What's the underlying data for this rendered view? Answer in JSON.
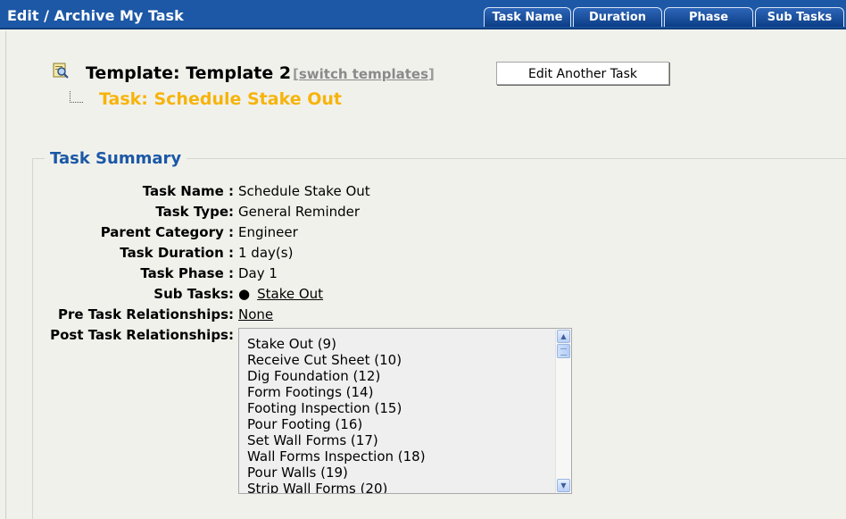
{
  "header": {
    "title": "Edit / Archive My Task",
    "tabs": [
      {
        "label": "Task Name"
      },
      {
        "label": "Duration"
      },
      {
        "label": "Phase"
      },
      {
        "label": "Sub Tasks"
      }
    ]
  },
  "template": {
    "label": "Template: Template 2",
    "switch_link": "switch templates",
    "edit_button": "Edit Another Task"
  },
  "task": {
    "label": "Task: Schedule Stake Out"
  },
  "summary": {
    "legend": "Task Summary",
    "fields": [
      {
        "label": "Task Name :",
        "value": "Schedule Stake Out"
      },
      {
        "label": "Task Type:",
        "value": "General Reminder"
      },
      {
        "label": "Parent Category :",
        "value": "Engineer"
      },
      {
        "label": "Task Duration :",
        "value": "1 day(s)"
      },
      {
        "label": "Task Phase :",
        "value": "Day 1"
      },
      {
        "label": "Sub Tasks:",
        "value": "Stake Out"
      },
      {
        "label": "Pre Task Relationships:",
        "value": "None"
      },
      {
        "label": "Post Task Relationships:"
      }
    ],
    "post_relationships": [
      "Stake Out (9)",
      "Receive Cut Sheet (10)",
      "Dig Foundation (12)",
      "Form Footings (14)",
      "Footing Inspection (15)",
      "Pour Footing (16)",
      "Set Wall Forms (17)",
      "Wall Forms Inspection (18)",
      "Pour Walls (19)",
      "Strip Wall Forms (20)"
    ]
  },
  "icons": {
    "template": "magnifier-document-icon",
    "scroll_up": "scroll-up-arrow-icon",
    "scroll_down": "scroll-down-arrow-icon",
    "bullet": "bullet-icon"
  },
  "colors": {
    "header_bg": "#1c58a6",
    "task_label": "#f6b40b",
    "legend": "#1b58a6"
  }
}
